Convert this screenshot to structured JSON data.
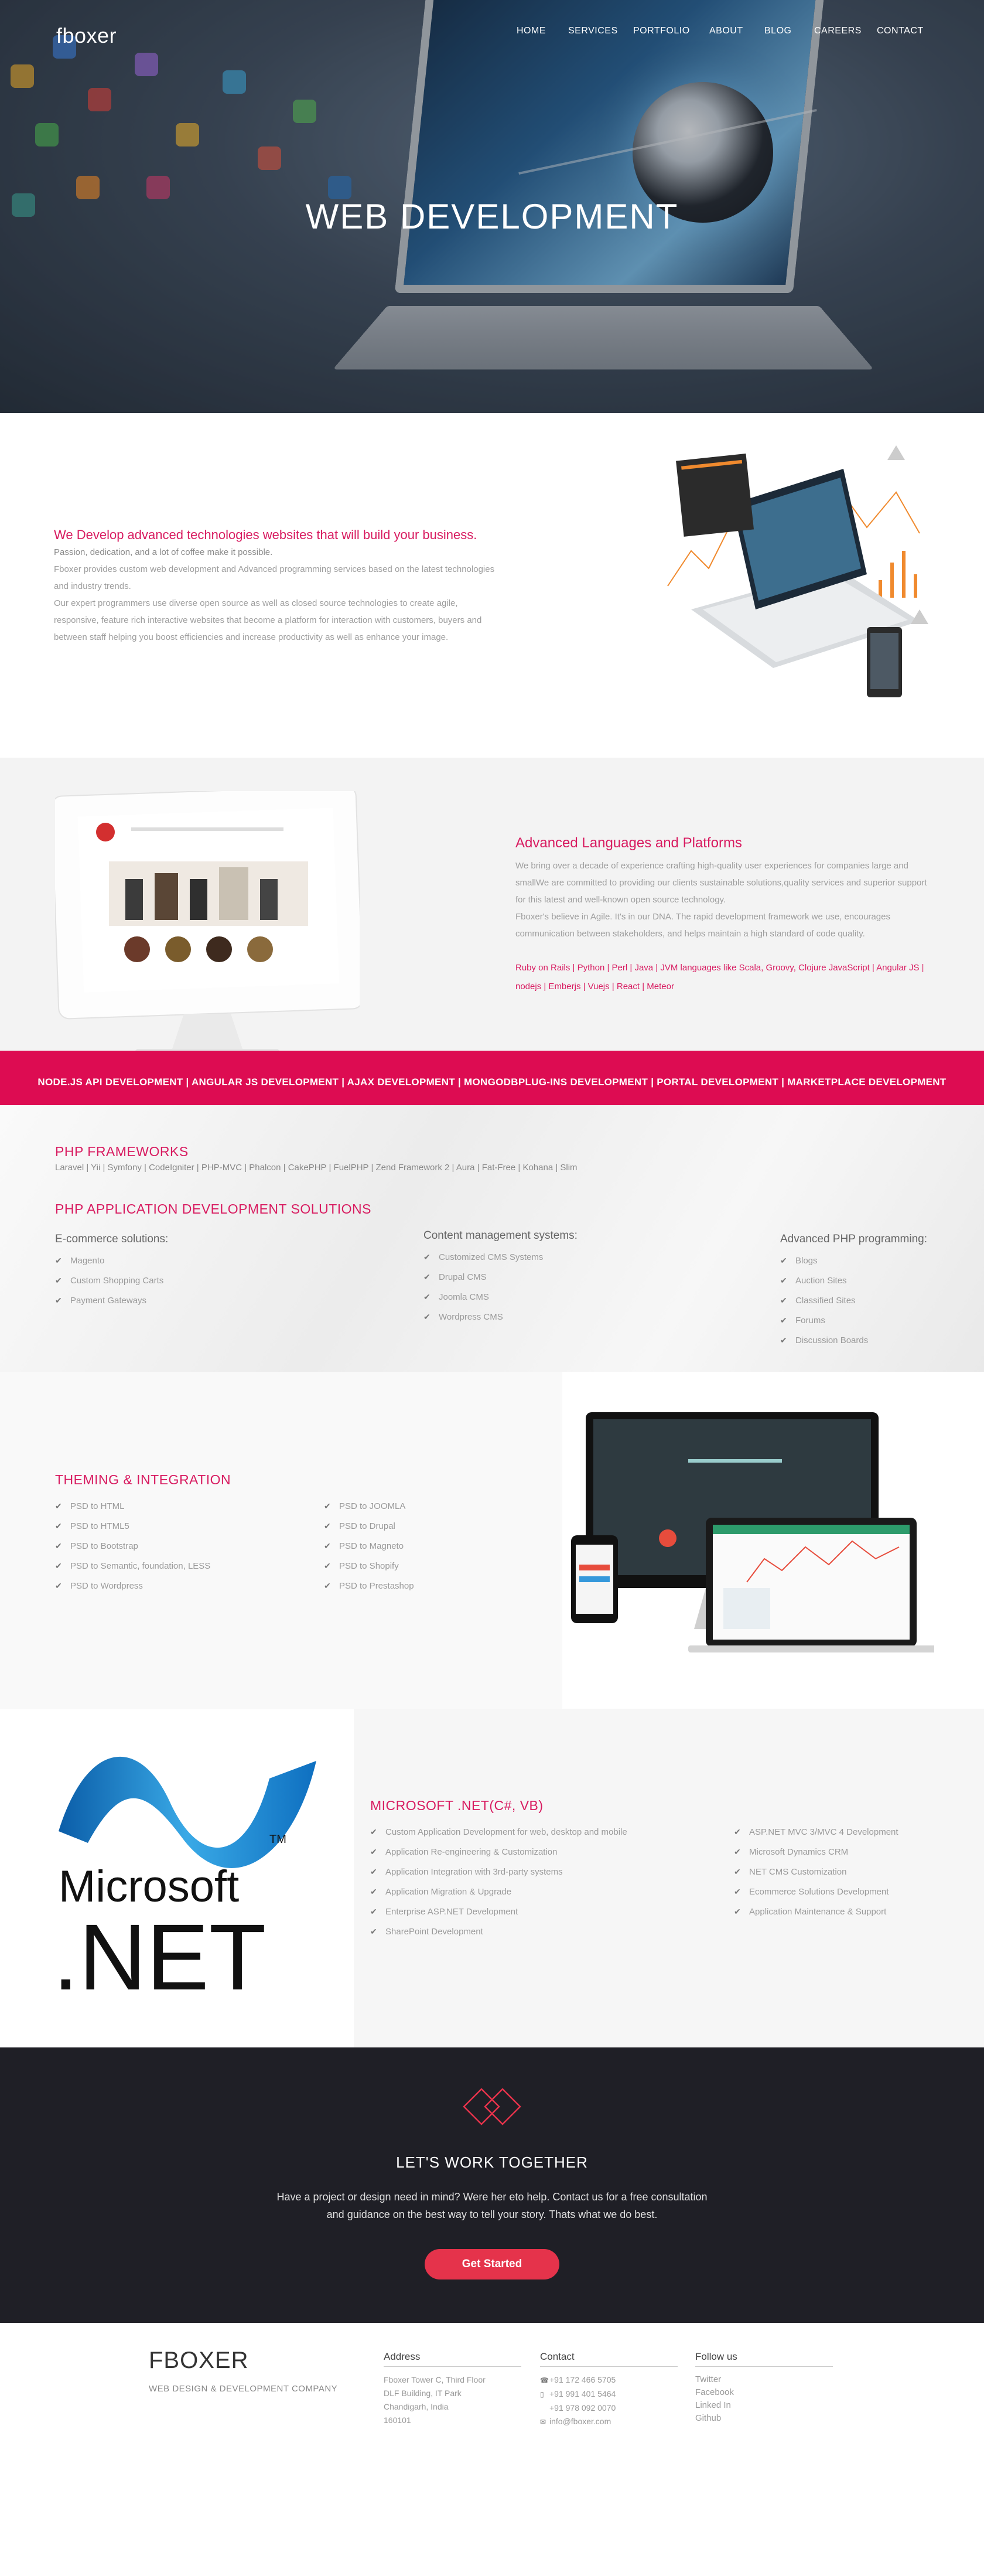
{
  "header": {
    "logo": "fboxer",
    "nav": [
      "HOME",
      "SERVICES",
      "PORTFOLIO",
      "ABOUT",
      "BLOG",
      "CAREERS",
      "CONTACT"
    ],
    "hero_title": "WEB DEVELOPMENT"
  },
  "intro": {
    "heading": "We Develop advanced technologies websites that will build your business.",
    "lines": [
      "Passion, dedication, and a lot of coffee make it possible.",
      "Fboxer provides custom web development and Advanced programming services based on the latest technologies and industry trends.",
      "Our expert programmers use diverse open source as well as closed source technologies to create agile, responsive, feature rich interactive websites that become a platform for interaction with customers, buyers and between staff helping you boost efficiencies and increase productivity as well as enhance your image."
    ]
  },
  "advanced": {
    "heading": "Advanced Languages and Platforms",
    "lines": [
      "We bring over a decade of experience crafting high-quality user experiences for companies large and smallWe are committed to providing our clients sustainable solutions,quality services and superior support for this latest and well-known open source technology.",
      "Fboxer's believe in Agile. It's in our DNA. The rapid development framework we use, encourages communication between stakeholders, and helps maintain a high standard of code quality."
    ],
    "languages": "Ruby on Rails | Python | Perl | Java | JVM languages like Scala, Groovy, Clojure JavaScript | Angular JS | nodejs | Emberjs | Vuejs | React | Meteor"
  },
  "pinkbar": {
    "text": "NODE.JS API DEVELOPMENT | ANGULAR JS DEVELOPMENT |  AJAX DEVELOPMENT | MONGODBPLUG-INS DEVELOPMENT | PORTAL DEVELOPMENT | MARKETPLACE DEVELOPMENT"
  },
  "php": {
    "frameworks_heading": "PHP FRAMEWORKS",
    "frameworks_list": "Laravel | Yii | Symfony | CodeIgniter | PHP-MVC | Phalcon | CakePHP | FuelPHP | Zend Framework 2 | Aura | Fat-Free | Kohana | Slim",
    "solutions_heading": "PHP APPLICATION DEVELOPMENT SOLUTIONS",
    "columns": [
      {
        "title": "E-commerce solutions:",
        "items": [
          "Magento",
          "Custom Shopping Carts",
          "Payment Gateways"
        ]
      },
      {
        "title": "Content management systems:",
        "items": [
          "Customized CMS Systems",
          "Drupal CMS",
          "Joomla CMS",
          "Wordpress CMS"
        ]
      },
      {
        "title": "Advanced PHP programming:",
        "items": [
          "Blogs",
          "Auction Sites",
          "Classified Sites",
          "Forums",
          "Discussion Boards"
        ]
      }
    ]
  },
  "theming": {
    "heading": "THEMING & INTEGRATION",
    "col1": [
      "PSD to HTML",
      "PSD to HTML5",
      "PSD to Bootstrap",
      "PSD to Semantic, foundation, LESS",
      "PSD to Wordpress"
    ],
    "col2": [
      "PSD to JOOMLA",
      "PSD to Drupal",
      "PSD to Magneto",
      "PSD to Shopify",
      "PSD to Prestashop"
    ]
  },
  "dotnet": {
    "logo_word1": "Microsoft",
    "logo_word2": ".NET",
    "heading": "MICROSOFT .NET(C#, VB)",
    "col1": [
      "Custom Application Development for web, desktop and mobile",
      "Application Re-engineering & Customization",
      "Application Integration with 3rd-party systems",
      "Application Migration & Upgrade",
      "Enterprise ASP.NET Development",
      "SharePoint Development"
    ],
    "col2": [
      "ASP.NET MVC 3/MVC 4 Development",
      "Microsoft Dynamics CRM",
      "NET CMS Customization",
      "Ecommerce Solutions Development",
      "Application Maintenance & Support"
    ]
  },
  "cta": {
    "title": "LET'S WORK TOGETHER",
    "line1": "Have a project or design need in mind? Were her eto help. Contact us for a free consultation",
    "line2": "and guidance on the best way to tell your story. Thats what we do best.",
    "button": "Get Started"
  },
  "footer": {
    "brand": "FBOXER",
    "tagline": "WEB DESIGN & DEVELOPMENT COMPANY",
    "address_head": "Address",
    "address": [
      "Fboxer Tower C, Third Floor",
      "DLF Building, IT Park",
      "Chandigarh, India",
      "160101"
    ],
    "contact_head": "Contact",
    "contact": [
      "+91 172 466 5705",
      "+91 991 401 5464",
      "+91 978 092 0070",
      "info@fboxer.com"
    ],
    "follow_head": "Follow us",
    "follow": [
      "Twitter",
      "Facebook",
      "Linked In",
      "Github"
    ]
  },
  "colors": {
    "accent": "#d81b60",
    "pinkbar": "#dd0c52",
    "cta_bg": "#1f1f26",
    "cta_button": "#e5334b"
  },
  "icons": [
    "check-icon",
    "phone-icon",
    "mobile-icon",
    "envelope-icon",
    "diamond-logo-icon"
  ]
}
